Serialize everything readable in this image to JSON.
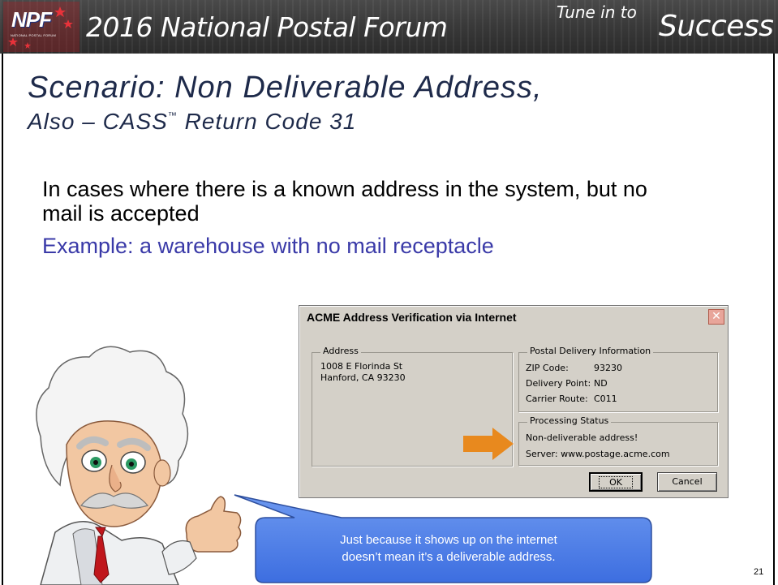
{
  "banner": {
    "logo_text": "NPF",
    "logo_subtext": "NATIONAL POSTAL FORUM",
    "title": "2016 National Postal Forum",
    "tagline_small": "Tune in to",
    "tagline_large": "Success"
  },
  "slide": {
    "title_line1": "Scenario: Non Deliverable Address,",
    "title_line2_prefix": "Also – CASS",
    "title_line2_tm": "™",
    "title_line2_suffix": " Return Code 31",
    "body_text": "In cases where there is a known address in the system, but no mail is accepted",
    "example_text": "Example: a warehouse with no mail receptacle",
    "page_number": "21"
  },
  "dialog": {
    "title": "ACME Address Verification via Internet",
    "close_glyph": "✕",
    "address_group": {
      "label": "Address",
      "line1": "1008 E Florinda St",
      "line2": "Hanford, CA 93230"
    },
    "postal_group": {
      "label": "Postal Delivery Information",
      "zip_label": "ZIP Code:",
      "zip_value": "93230",
      "dp_label": "Delivery Point:",
      "dp_value": "ND",
      "cr_label": "Carrier Route:",
      "cr_value": "C011"
    },
    "status_group": {
      "label": "Processing Status",
      "status": "Non-deliverable address!",
      "server": "Server:  www.postage.acme.com"
    },
    "ok_label": "OK",
    "cancel_label": "Cancel"
  },
  "callout": {
    "line1": "Just because it shows up on the internet",
    "line2": "doesn’t mean it’s a deliverable address."
  },
  "colors": {
    "banner": "#3a3a3a",
    "title_text": "#1e2a4a",
    "example_text": "#3a3aa8",
    "dialog_face": "#d4d0c8",
    "arrow": "#e8891e",
    "callout": "#4a7ae8"
  }
}
